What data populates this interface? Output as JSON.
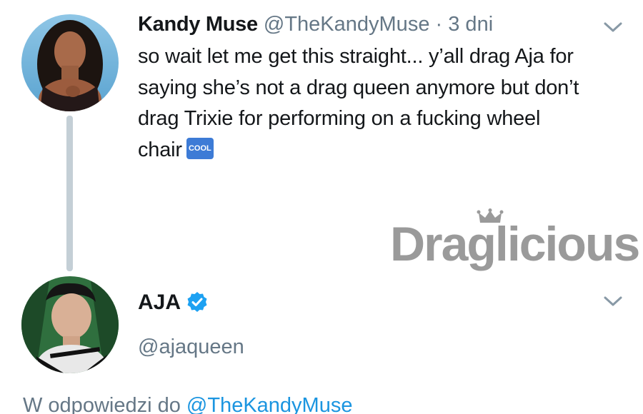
{
  "tweet": {
    "author": {
      "display_name": "Kandy Muse",
      "handle": "@TheKandyMuse",
      "avatar": "avatar-kandy-muse"
    },
    "separator": "·",
    "time": "3 dni",
    "text_lines": [
      "so wait let me get this straight... y’all drag Aja for",
      "saying she’s not a drag queen anymore but don’t",
      "drag Trixie for performing on a fucking wheel",
      "chair"
    ],
    "emoji": "COOL",
    "menu_icon": "chevron-down-icon"
  },
  "watermark": {
    "text": "Draglicious"
  },
  "reply": {
    "author": {
      "display_name": "AJA",
      "handle": "@ajaqueen",
      "verified_icon": "verified-badge-icon",
      "avatar": "avatar-aja"
    },
    "menu_icon": "chevron-down-icon",
    "reply_prefix": "W odpowiedzi do",
    "reply_to": "@TheKandyMuse"
  },
  "colors": {
    "text_primary": "#14171a",
    "text_secondary": "#657786",
    "link": "#1b95e0",
    "thread_line": "#c4cfd6",
    "verified": "#1da1f2"
  }
}
